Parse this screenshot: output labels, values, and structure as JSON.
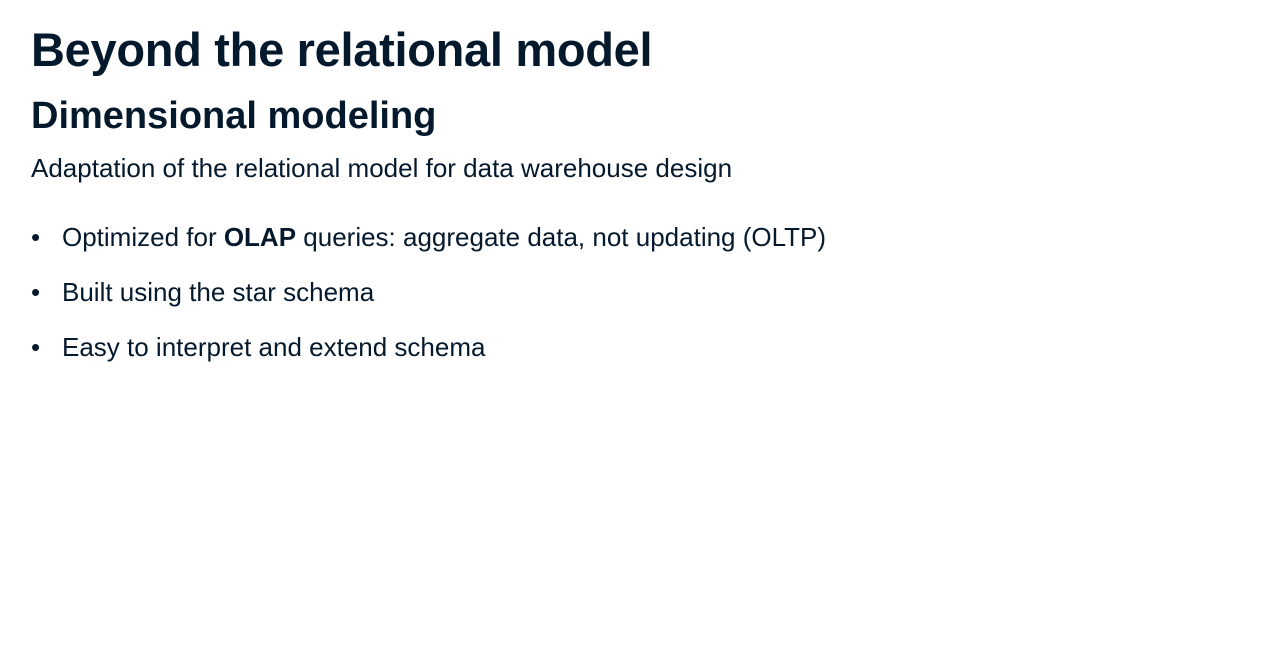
{
  "slide": {
    "title": "Beyond the relational model",
    "subtitle": "Dimensional modeling",
    "lead": "Adaptation of the relational model for data warehouse design",
    "bullets": [
      {
        "marker": "•",
        "before": "Optimized for ",
        "bold": "OLAP",
        "after": " queries: aggregate data, not updating (OLTP)"
      },
      {
        "marker": "•",
        "text": "Built using the star schema"
      },
      {
        "marker": "•",
        "text": "Easy to interpret and extend schema"
      }
    ]
  },
  "colors": {
    "text": "#05192d",
    "background": "#ffffff"
  }
}
